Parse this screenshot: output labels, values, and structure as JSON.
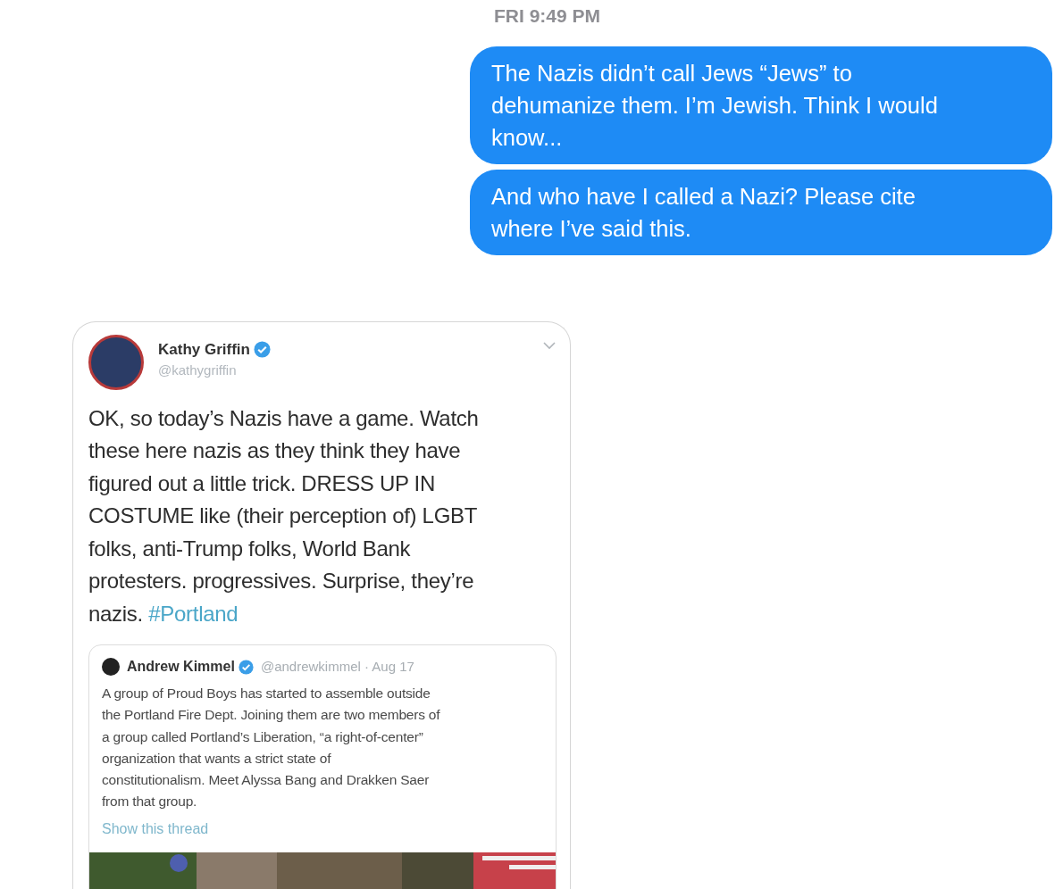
{
  "timestamp": "FRI 9:49 PM",
  "messages": [
    {
      "text": "The Nazis didn’t call Jews “Jews” to dehumanize them. I’m Jewish. Think I would know..."
    },
    {
      "text": "And who have I called a Nazi? Please cite where I’ve said this."
    }
  ],
  "tweet": {
    "name": "Kathy Griffin",
    "verified": true,
    "handle": "@kathygriffin",
    "lines": [
      "OK, so today’s Nazis have a game. Watch",
      "these here nazis as they think they have",
      "figured out a little trick. DRESS UP IN",
      "COSTUME like (their perception of) LGBT",
      "folks, anti-Trump folks, World Bank",
      "protesters. progressives.  Surprise, they’re",
      "nazis. "
    ],
    "hashtag": "#Portland",
    "quote": {
      "name": "Andrew Kimmel",
      "verified": true,
      "meta": "@andrewkimmel · Aug 17",
      "lines": [
        "A group of Proud Boys has started to assemble outside",
        "the Portland Fire Dept. Joining them are two members of",
        "a group called Portland’s Liberation, “a right-of-center”",
        "organization that wants a strict state of",
        "constitutionalism. Meet Alyssa Bang and Drakken Saer",
        "from that group."
      ],
      "link": "Show this thread",
      "media": {
        "kind": "picture"
      }
    }
  }
}
